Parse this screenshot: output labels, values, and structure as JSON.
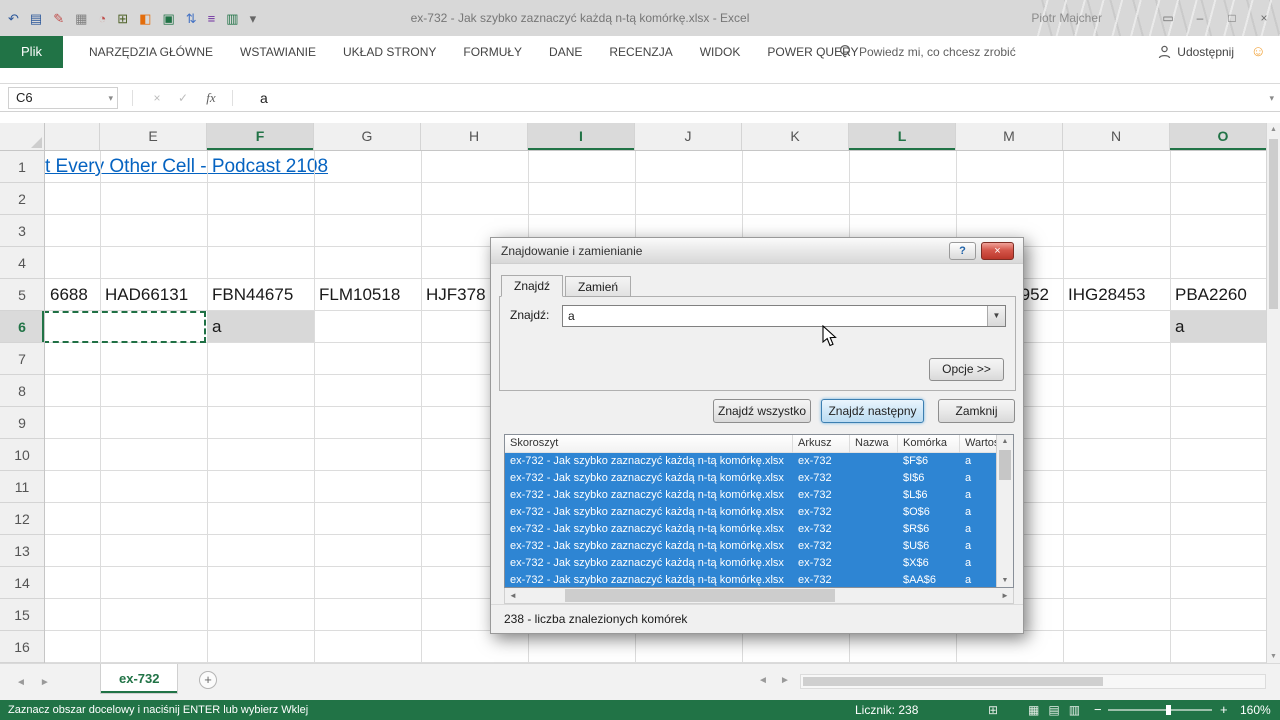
{
  "titlebar": {
    "title": "ex-732 - Jak szybko zaznaczyć każdą n-tą komórkę.xlsx -  Excel",
    "user": "Piotr Majcher",
    "qat": [
      {
        "name": "undo-icon",
        "glyph": "↶",
        "color": "#2b579a"
      },
      {
        "name": "save-icon",
        "glyph": "▤",
        "color": "#2b579a"
      },
      {
        "name": "format-painter-icon",
        "glyph": "✎",
        "color": "#c0504d"
      },
      {
        "name": "paste-special-icon",
        "glyph": "▦",
        "color": "#7f7f7f"
      },
      {
        "name": "recent-file-icon",
        "glyph": "◔",
        "color": "#c0504d"
      },
      {
        "name": "calculator-icon",
        "glyph": "⊞",
        "color": "#4f6228"
      },
      {
        "name": "fill-color-icon",
        "glyph": "◧",
        "color": "#e36c0a"
      },
      {
        "name": "new-sheet-icon",
        "glyph": "▣",
        "color": "#217346"
      },
      {
        "name": "sort-icon",
        "glyph": "⇅",
        "color": "#4472c4"
      },
      {
        "name": "freeze-panes-icon",
        "glyph": "≡",
        "color": "#7030a0"
      },
      {
        "name": "chart-icon",
        "glyph": "▥",
        "color": "#217346"
      },
      {
        "name": "qat-customize-icon",
        "glyph": "▾",
        "color": "#666666"
      }
    ],
    "window_controls": [
      {
        "name": "ribbon-display-options-icon",
        "glyph": "▭"
      },
      {
        "name": "minimize-button",
        "glyph": "–"
      },
      {
        "name": "restore-button",
        "glyph": "□"
      },
      {
        "name": "close-window-button",
        "glyph": "×"
      }
    ]
  },
  "ribbon": {
    "file_tab": "Plik",
    "tabs": [
      "NARZĘDZIA GŁÓWNE",
      "WSTAWIANIE",
      "UKŁAD STRONY",
      "FORMUŁY",
      "DANE",
      "RECENZJA",
      "WIDOK",
      "POWER QUERY"
    ],
    "tell_me": "Powiedz mi, co chcesz zrobić",
    "share_label": "Udostępnij",
    "smiley": "☺"
  },
  "formula_bar": {
    "name_box": "C6",
    "value": "a",
    "fx": "fx",
    "cancel": "×",
    "enter": "✓",
    "dropdown": "▾"
  },
  "icons": {
    "up": "▲",
    "down": "▼",
    "left": "◄",
    "right": "►"
  },
  "grid": {
    "columns": [
      "E",
      "F",
      "G",
      "H",
      "I",
      "J",
      "K",
      "L",
      "M",
      "N",
      "O"
    ],
    "selected_columns": [
      "F",
      "I",
      "L",
      "O"
    ],
    "rows": [
      1,
      2,
      3,
      4,
      5,
      6,
      7,
      8,
      9,
      10,
      11,
      12,
      13,
      14,
      15,
      16
    ],
    "selected_rows": [
      6
    ],
    "hyperlink": "t Every Other Cell - Podcast 2108",
    "cells": [
      {
        "col": "D",
        "row": 5,
        "text": "6688"
      },
      {
        "col": "E",
        "row": 5,
        "text": "HAD66131"
      },
      {
        "col": "F",
        "row": 5,
        "text": "FBN44675"
      },
      {
        "col": "G",
        "row": 5,
        "text": "FLM10518"
      },
      {
        "col": "H",
        "row": 5,
        "text": "HJF378"
      },
      {
        "col": "M",
        "row": 5,
        "text": "952",
        "align": "right"
      },
      {
        "col": "N",
        "row": 5,
        "text": "IHG28453"
      },
      {
        "col": "O",
        "row": 5,
        "text": "PBA2260"
      },
      {
        "col": "F",
        "row": 6,
        "text": "a",
        "fill": true
      },
      {
        "col": "O",
        "row": 6,
        "text": "a",
        "fill": true
      }
    ]
  },
  "dialog": {
    "title": "Znajdowanie i zamienianie",
    "help": "?",
    "close": "×",
    "tabs": [
      "Znajdź",
      "Zamień"
    ],
    "find_label": "Znajdź:",
    "find_value": "a",
    "options_button": "Opcje >>",
    "find_all_button": "Znajdź wszystko",
    "find_next_button": "Znajdź następny",
    "close_button": "Zamknij",
    "results": {
      "headers": [
        "Skoroszyt",
        "Arkusz",
        "Nazwa",
        "Komórka",
        "Wartość"
      ],
      "rows": [
        {
          "workbook": "ex-732 - Jak szybko zaznaczyć każdą n-tą komórkę.xlsx",
          "sheet": "ex-732",
          "name": "",
          "cell": "$F$6",
          "value": "a"
        },
        {
          "workbook": "ex-732 - Jak szybko zaznaczyć każdą n-tą komórkę.xlsx",
          "sheet": "ex-732",
          "name": "",
          "cell": "$I$6",
          "value": "a"
        },
        {
          "workbook": "ex-732 - Jak szybko zaznaczyć każdą n-tą komórkę.xlsx",
          "sheet": "ex-732",
          "name": "",
          "cell": "$L$6",
          "value": "a"
        },
        {
          "workbook": "ex-732 - Jak szybko zaznaczyć każdą n-tą komórkę.xlsx",
          "sheet": "ex-732",
          "name": "",
          "cell": "$O$6",
          "value": "a"
        },
        {
          "workbook": "ex-732 - Jak szybko zaznaczyć każdą n-tą komórkę.xlsx",
          "sheet": "ex-732",
          "name": "",
          "cell": "$R$6",
          "value": "a"
        },
        {
          "workbook": "ex-732 - Jak szybko zaznaczyć każdą n-tą komórkę.xlsx",
          "sheet": "ex-732",
          "name": "",
          "cell": "$U$6",
          "value": "a"
        },
        {
          "workbook": "ex-732 - Jak szybko zaznaczyć każdą n-tą komórkę.xlsx",
          "sheet": "ex-732",
          "name": "",
          "cell": "$X$6",
          "value": "a"
        },
        {
          "workbook": "ex-732 - Jak szybko zaznaczyć każdą n-tą komórkę.xlsx",
          "sheet": "ex-732",
          "name": "",
          "cell": "$AA$6",
          "value": "a"
        }
      ]
    },
    "status": "238 - liczba znalezionych komórek"
  },
  "sheet_bar": {
    "active_tab": "ex-732",
    "add_sheet": "+"
  },
  "status_bar": {
    "message": "Zaznacz obszar docelowy i naciśnij ENTER lub wybierz Wklej",
    "counter": "Licznik: 238",
    "grid_icon": "⊞",
    "view_icons": [
      {
        "name": "normal-view-icon",
        "glyph": "▦"
      },
      {
        "name": "page-layout-view-icon",
        "glyph": "▤"
      },
      {
        "name": "page-break-view-icon",
        "glyph": "▥"
      }
    ],
    "zoom_out": "−",
    "zoom_in": "+",
    "zoom": "160%"
  }
}
